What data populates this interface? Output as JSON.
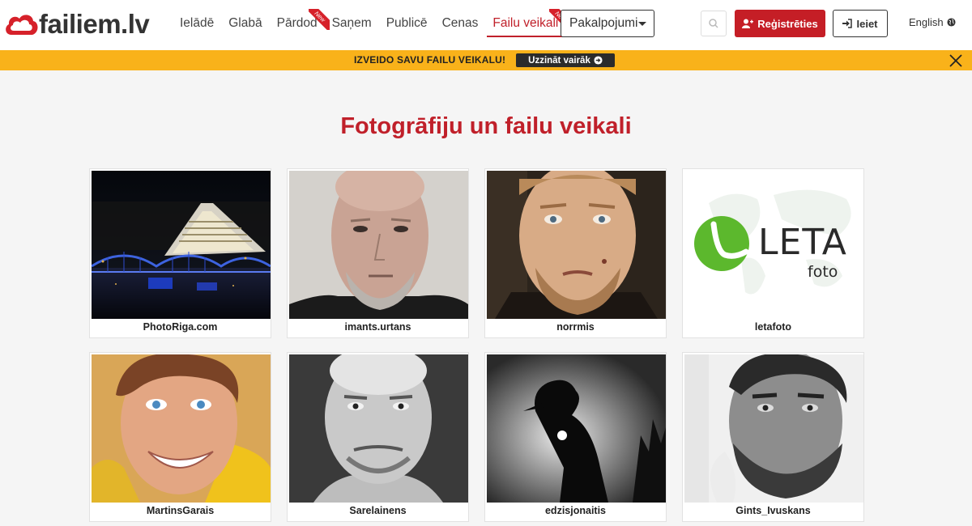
{
  "brand": {
    "logo_text": "failiem.lv"
  },
  "nav": {
    "items": [
      {
        "label": "Ielādē",
        "new": false,
        "active": false
      },
      {
        "label": "Glabā",
        "new": false,
        "active": false
      },
      {
        "label": "Pārdod",
        "new": true,
        "active": false
      },
      {
        "label": "Saņem",
        "new": false,
        "active": false
      },
      {
        "label": "Publicē",
        "new": false,
        "active": false
      },
      {
        "label": "Cenas",
        "new": false,
        "active": false
      },
      {
        "label": "Failu veikali",
        "new": true,
        "active": true
      }
    ],
    "new_badge_label": "New",
    "services_dropdown": "Pakalpojumi",
    "register_label": "Reģistrēties",
    "login_label": "Ieiet",
    "language_label": "English"
  },
  "banner": {
    "text": "IZVEIDO SAVU FAILU VEIKALU!",
    "button_label": "Uzzināt vairāk"
  },
  "main": {
    "title": "Fotogrāfiju un failu veikali",
    "stores": [
      {
        "name": "PhotoRiga.com"
      },
      {
        "name": "imants.urtans"
      },
      {
        "name": "norrmis"
      },
      {
        "name": "letafoto",
        "logo_text": "LETA",
        "logo_sub": "foto"
      },
      {
        "name": "MartinsGarais"
      },
      {
        "name": "Sarelainens"
      },
      {
        "name": "edzisjonaitis"
      },
      {
        "name": "Gints_Ivuskans"
      }
    ]
  },
  "colors": {
    "brand_red": "#c0202a",
    "banner_yellow": "#f9b21a",
    "register_red": "#c51e26",
    "leta_green": "#5cb82d"
  },
  "icons": {
    "logo": "cloud-logo-icon",
    "search": "search-icon",
    "register": "user-plus-icon",
    "login": "sign-in-icon",
    "language": "globe-icon",
    "banner_button": "arrow-circle-right-icon",
    "banner_close": "close-icon",
    "dropdown": "caret-down-icon"
  }
}
